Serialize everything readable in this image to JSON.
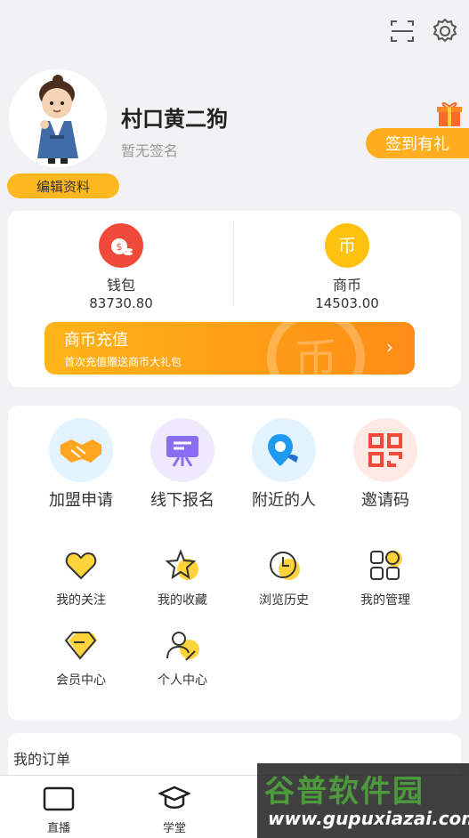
{
  "header": {
    "scan_icon": "scan-icon",
    "settings_icon": "gear-icon"
  },
  "profile": {
    "username": "村口黄二狗",
    "signature": "暂无签名",
    "edit_label": "编辑资料",
    "checkin_label": "签到有礼"
  },
  "wallet": {
    "items": [
      {
        "label": "钱包",
        "value": "83730.80",
        "color": "#f04b3a"
      },
      {
        "label": "商币",
        "value": "14503.00",
        "color": "#ffc20e"
      }
    ],
    "recharge_title": "商币充值",
    "recharge_subtitle": "首次充值赠送商币大礼包"
  },
  "menu": {
    "big": [
      {
        "label": "加盟申请",
        "icon": "handshake-icon"
      },
      {
        "label": "线下报名",
        "icon": "easel-icon"
      },
      {
        "label": "附近的人",
        "icon": "location-person-icon"
      },
      {
        "label": "邀请码",
        "icon": "qr-code-icon"
      }
    ],
    "small": [
      {
        "label": "我的关注",
        "icon": "heart-icon"
      },
      {
        "label": "我的收藏",
        "icon": "star-icon"
      },
      {
        "label": "浏览历史",
        "icon": "clock-icon"
      },
      {
        "label": "我的管理",
        "icon": "grid-icon"
      },
      {
        "label": "会员中心",
        "icon": "diamond-icon"
      },
      {
        "label": "个人中心",
        "icon": "user-icon"
      }
    ]
  },
  "orders": {
    "title": "我的订单"
  },
  "tabbar": {
    "tabs": [
      {
        "label": "直播",
        "icon": "video-icon"
      },
      {
        "label": "学堂",
        "icon": "graduation-cap-icon"
      }
    ]
  },
  "watermark": {
    "line1": "谷普软件园",
    "line2": "www.gupuxiazai.com"
  }
}
